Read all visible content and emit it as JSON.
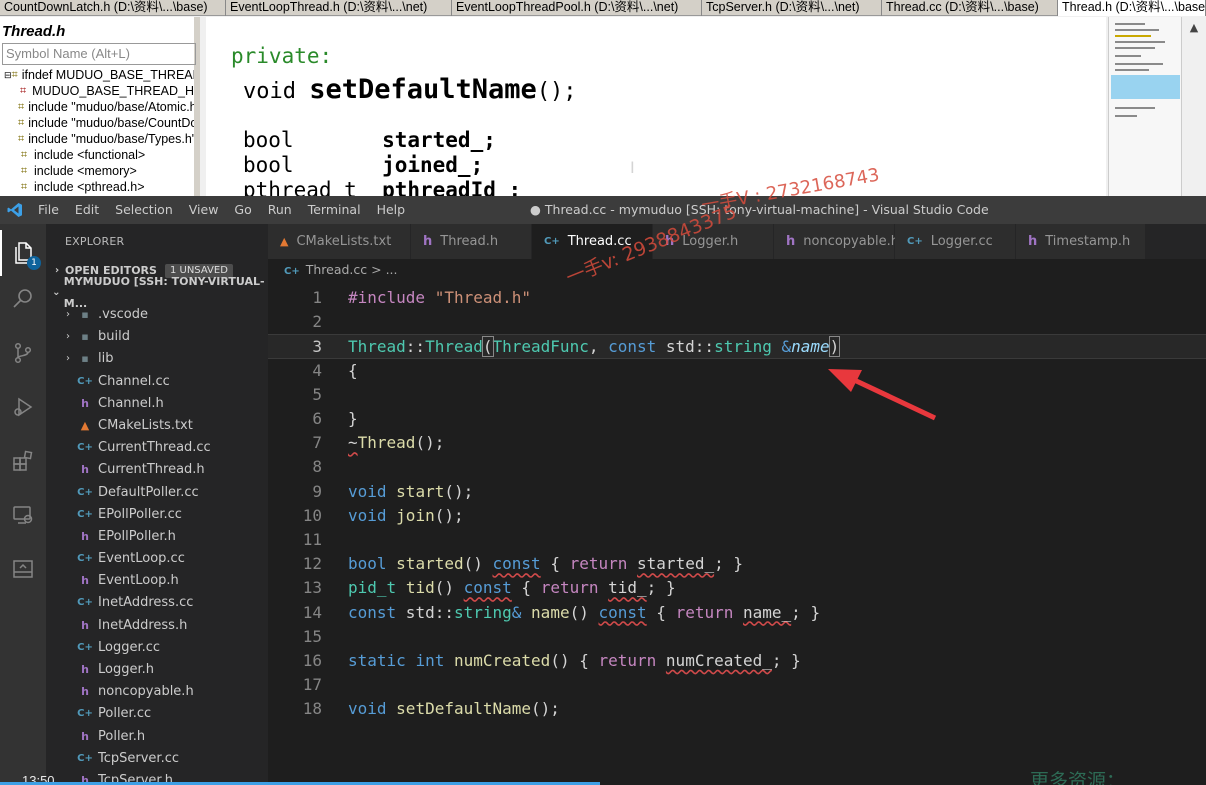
{
  "background_app": {
    "tabs": [
      "CountDownLatch.h (D:\\资料\\...\\base)",
      "EventLoopThread.h (D:\\资料\\...\\net)",
      "EventLoopThreadPool.h (D:\\资料\\...\\net)",
      "TcpServer.h (D:\\资料\\...\\net)",
      "Thread.cc (D:\\资料\\...\\base)",
      "Thread.h (D:\\资料\\...\\base)"
    ],
    "panel_title": "Thread.h",
    "search_placeholder": "Symbol Name (Alt+L)",
    "tree": [
      "ifndef MUDUO_BASE_THREAD_H",
      "MUDUO_BASE_THREAD_H",
      "include \"muduo/base/Atomic.h\"",
      "include \"muduo/base/CountDownLatch.h\"",
      "include \"muduo/base/Types.h\"",
      "include <functional>",
      "include <memory>",
      "include <pthread.h>"
    ],
    "code": {
      "line1": "private:",
      "line2_kw": "void ",
      "line2_fn": "setDefaultName",
      "line2_end": "();",
      "line3_type": "bool       ",
      "line3_var": "started_;",
      "line4_type": "bool       ",
      "line4_var": "joined_;",
      "line5_type": "pthread_t  ",
      "line5_var": "pthreadId_;"
    }
  },
  "window": {
    "title": "● Thread.cc - mymuduo [SSH: tony-virtual-machine] - Visual Studio Code",
    "menu": [
      "File",
      "Edit",
      "Selection",
      "View",
      "Go",
      "Run",
      "Terminal",
      "Help"
    ]
  },
  "activity_bar": {
    "badge": "1"
  },
  "explorer": {
    "title": "EXPLORER",
    "open_editors": "OPEN EDITORS",
    "unsaved": "1 UNSAVED",
    "workspace": "MYMUDUO [SSH: TONY-VIRTUAL-M...",
    "items": [
      {
        "name": ".vscode",
        "kind": "folder"
      },
      {
        "name": "build",
        "kind": "folder"
      },
      {
        "name": "lib",
        "kind": "folder"
      },
      {
        "name": "Channel.cc",
        "kind": "cc"
      },
      {
        "name": "Channel.h",
        "kind": "h"
      },
      {
        "name": "CMakeLists.txt",
        "kind": "cmake"
      },
      {
        "name": "CurrentThread.cc",
        "kind": "cc"
      },
      {
        "name": "CurrentThread.h",
        "kind": "h"
      },
      {
        "name": "DefaultPoller.cc",
        "kind": "cc"
      },
      {
        "name": "EPollPoller.cc",
        "kind": "cc"
      },
      {
        "name": "EPollPoller.h",
        "kind": "h"
      },
      {
        "name": "EventLoop.cc",
        "kind": "cc"
      },
      {
        "name": "EventLoop.h",
        "kind": "h"
      },
      {
        "name": "InetAddress.cc",
        "kind": "cc"
      },
      {
        "name": "InetAddress.h",
        "kind": "h"
      },
      {
        "name": "Logger.cc",
        "kind": "cc"
      },
      {
        "name": "Logger.h",
        "kind": "h"
      },
      {
        "name": "noncopyable.h",
        "kind": "h"
      },
      {
        "name": "Poller.cc",
        "kind": "cc"
      },
      {
        "name": "Poller.h",
        "kind": "h"
      },
      {
        "name": "TcpServer.cc",
        "kind": "cc"
      },
      {
        "name": "TcpServer.h",
        "kind": "h"
      }
    ]
  },
  "editor_tabs": [
    {
      "label": "CMakeLists.txt",
      "kind": "cmake"
    },
    {
      "label": "Thread.h",
      "kind": "h"
    },
    {
      "label": "Thread.cc",
      "kind": "cc",
      "active": true,
      "dirty": true
    },
    {
      "label": "Logger.h",
      "kind": "h"
    },
    {
      "label": "noncopyable.h",
      "kind": "h"
    },
    {
      "label": "Logger.cc",
      "kind": "cc"
    },
    {
      "label": "Timestamp.h",
      "kind": "h"
    }
  ],
  "breadcrumb": "Thread.cc > ...",
  "code_lines": [
    {
      "n": "1",
      "html": "<span class='pp'>#include</span> <span class='str'>\"Thread.h\"</span>"
    },
    {
      "n": "2",
      "html": ""
    },
    {
      "n": "3",
      "html": "<span class='ty'>Thread</span>::<span class='ty'>Thread</span><span class='bm'>(</span><span class='ty'>ThreadFunc</span>, <span class='kw'>const</span> std::<span class='ty'>string</span> <span class='kw'>&amp;</span><span class='par'>name</span><span class='bm'>)</span>",
      "current": true
    },
    {
      "n": "4",
      "html": "{"
    },
    {
      "n": "5",
      "html": ""
    },
    {
      "n": "6",
      "html": "}"
    },
    {
      "n": "7",
      "html": "<span class='sq'>~</span><span class='fn'>Thread</span>();"
    },
    {
      "n": "8",
      "html": ""
    },
    {
      "n": "9",
      "html": "<span class='kw'>void</span> <span class='fn'>start</span>();"
    },
    {
      "n": "10",
      "html": "<span class='kw'>void</span> <span class='fn'>join</span>();"
    },
    {
      "n": "11",
      "html": ""
    },
    {
      "n": "12",
      "html": "<span class='kw'>bool</span> <span class='fn'>started</span>() <span class='kw sq'>const</span> { <span class='ctl'>return</span> <span class='sq'>started_</span>; }"
    },
    {
      "n": "13",
      "html": "<span class='ty'>pid_t</span> <span class='fn'>tid</span>() <span class='kw sq'>const</span> { <span class='ctl'>return</span> <span class='sq'>tid_</span>; }"
    },
    {
      "n": "14",
      "html": "<span class='kw'>const</span> std::<span class='ty'>string</span><span class='kw'>&amp;</span> <span class='fn'>name</span>() <span class='kw sq'>const</span> { <span class='ctl'>return</span> <span class='sq'>name_</span>; }"
    },
    {
      "n": "15",
      "html": ""
    },
    {
      "n": "16",
      "html": "<span class='kw'>static</span> <span class='kw'>int</span> <span class='fn'>numCreated</span>() { <span class='ctl'>return</span> <span class='sq'>numCreated_</span>; }"
    },
    {
      "n": "17",
      "html": ""
    },
    {
      "n": "18",
      "html": "<span class='kw'>void</span> <span class='fn'>setDefaultName</span>();"
    }
  ],
  "overlays": {
    "watermark1": "一手V : 2732168743",
    "watermark2": "一手v: 2938843375",
    "clock": "13:50",
    "promo": "更多资源："
  },
  "colors": {
    "activity_bar": "#333333",
    "sidebar": "#252526",
    "editor_bg": "#1e1e1e",
    "accent": "#0e639c",
    "arrow": "#e8383d"
  }
}
